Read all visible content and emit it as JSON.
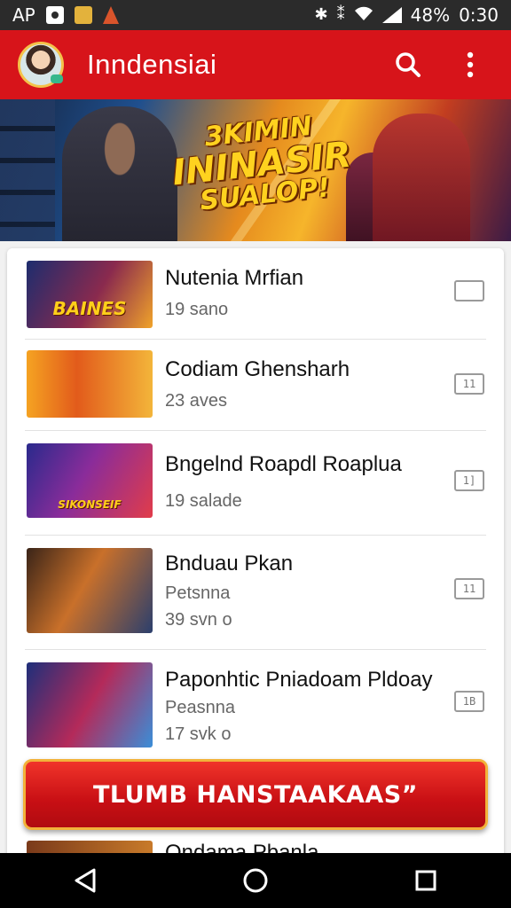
{
  "status_bar": {
    "left_label": "AP",
    "battery": "48%",
    "time": "0:30",
    "icons": [
      "doc-notification-icon",
      "folder-notification-icon",
      "fire-notification-icon",
      "bluetooth-icon",
      "vibrate-icon",
      "wifi-icon",
      "signal-icon"
    ]
  },
  "app_bar": {
    "title": "Inndensiai",
    "color": "#d7141a"
  },
  "banner": {
    "line1": "3KIMIN",
    "line2": "ININASIR",
    "line3": "SUALOP!"
  },
  "list": [
    {
      "title": "Nutenia Mrfian",
      "subtitle": "",
      "meta": "19 sano",
      "thumb_caption": "BAINES",
      "action": "  "
    },
    {
      "title": "Codiam Ghensharh",
      "subtitle": "",
      "meta": "23 aves",
      "thumb_caption": "",
      "action": "11"
    },
    {
      "title": "Bngelnd Roapdl Roaplua",
      "subtitle": "",
      "meta": "19 salade",
      "thumb_caption": "SIKONSEIF",
      "action": "1]"
    },
    {
      "title": "Bnduau Pkan",
      "subtitle": "Petsnna",
      "meta": "39 svn o",
      "thumb_caption": "",
      "action": "11"
    },
    {
      "title": "Paponhtic Pniadoam Pldoay",
      "subtitle": "Peasnna",
      "meta": "17 svk o",
      "thumb_caption": "",
      "action": "1B"
    },
    {
      "title": "Ondama Pbanla",
      "subtitle": "",
      "meta": "",
      "thumb_caption": "",
      "action": ""
    }
  ],
  "cta": {
    "label": "TLUMB HANSTAAKAAS”"
  },
  "colors": {
    "accent": "#d7141a",
    "cta_border": "#f2b23a"
  }
}
